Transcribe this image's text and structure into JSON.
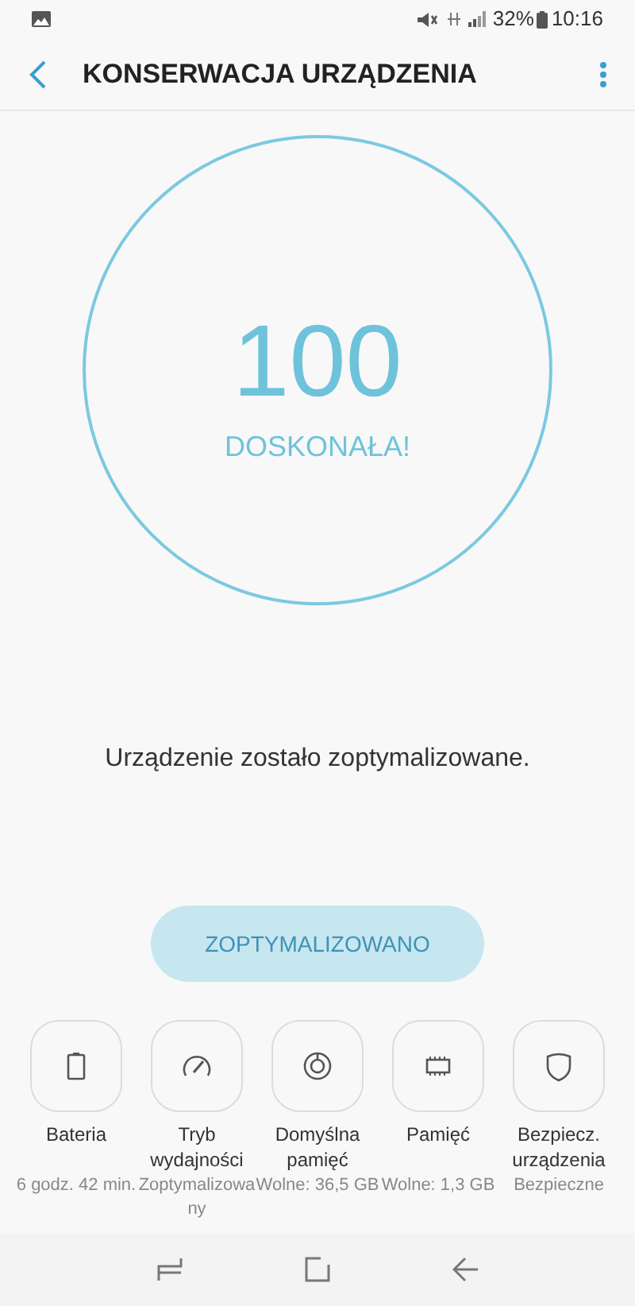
{
  "status_bar": {
    "battery": "32%",
    "time": "10:16"
  },
  "header": {
    "title": "KONSERWACJA URZĄDZENIA"
  },
  "score": {
    "value": "100",
    "label": "DOSKONAŁA!"
  },
  "message": "Urządzenie zostało zoptymalizowane.",
  "action_button": {
    "label": "ZOPTYMALIZOWANO",
    "disabled": true
  },
  "tiles": [
    {
      "kind": "battery",
      "label": "Bateria",
      "detail": "6 godz. 42 min."
    },
    {
      "kind": "performance",
      "label": "Tryb wydajności",
      "detail": "Zoptymalizowany"
    },
    {
      "kind": "storage",
      "label": "Domyślna pamięć",
      "detail": "Wolne: 36,5 GB"
    },
    {
      "kind": "memory",
      "label": "Pamięć",
      "detail": "Wolne: 1,3 GB"
    },
    {
      "kind": "security",
      "label": "Bezpiecz. urządzenia",
      "detail": "Bezpieczne"
    }
  ]
}
